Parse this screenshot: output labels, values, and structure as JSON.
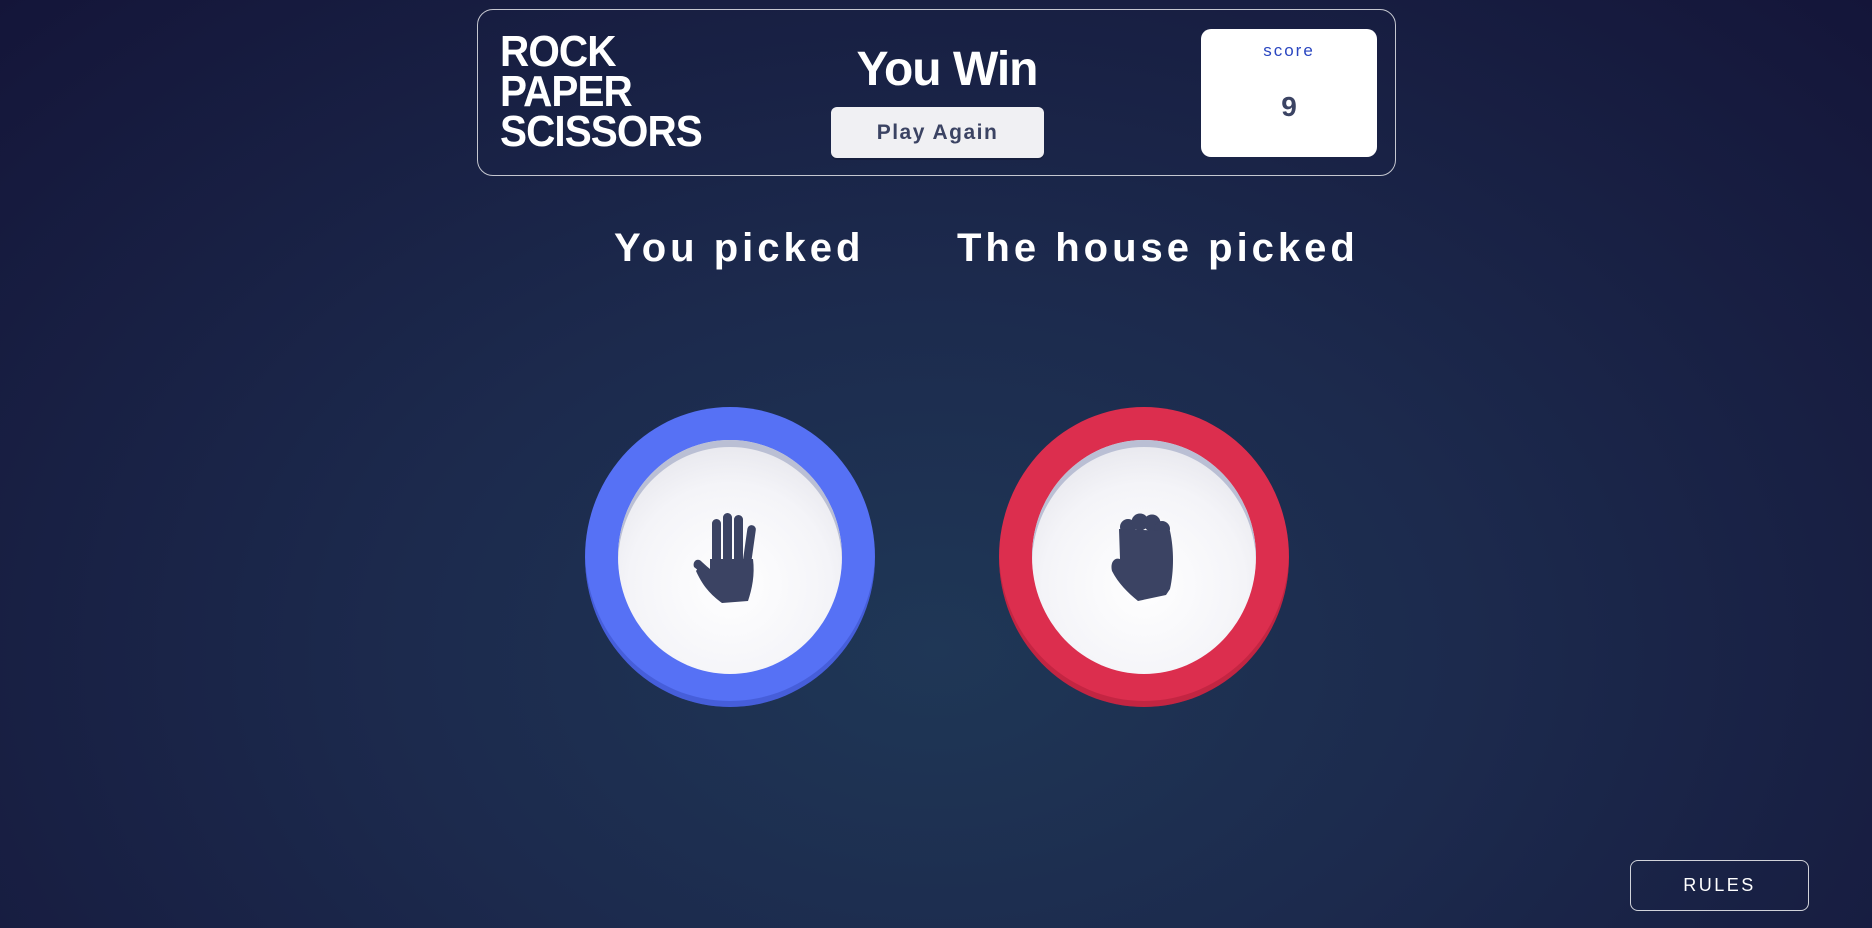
{
  "header": {
    "title_lines": [
      "ROCK",
      "PAPER",
      "SCISSORS"
    ],
    "result_text": "You Win",
    "play_again_label": "Play Again",
    "score_label": "score",
    "score_value": "9"
  },
  "picks": {
    "you_label": "You picked",
    "house_label": "The house picked",
    "you_choice": "paper",
    "house_choice": "rock"
  },
  "footer": {
    "rules_label": "RULES"
  },
  "colors": {
    "paper_ring": "#5671f5",
    "rock_ring": "#dc2e4e",
    "icon_fill": "#3b4363",
    "score_label": "#2a46c0"
  },
  "icons": {
    "paper": "paper-hand-icon",
    "rock": "rock-fist-icon"
  }
}
